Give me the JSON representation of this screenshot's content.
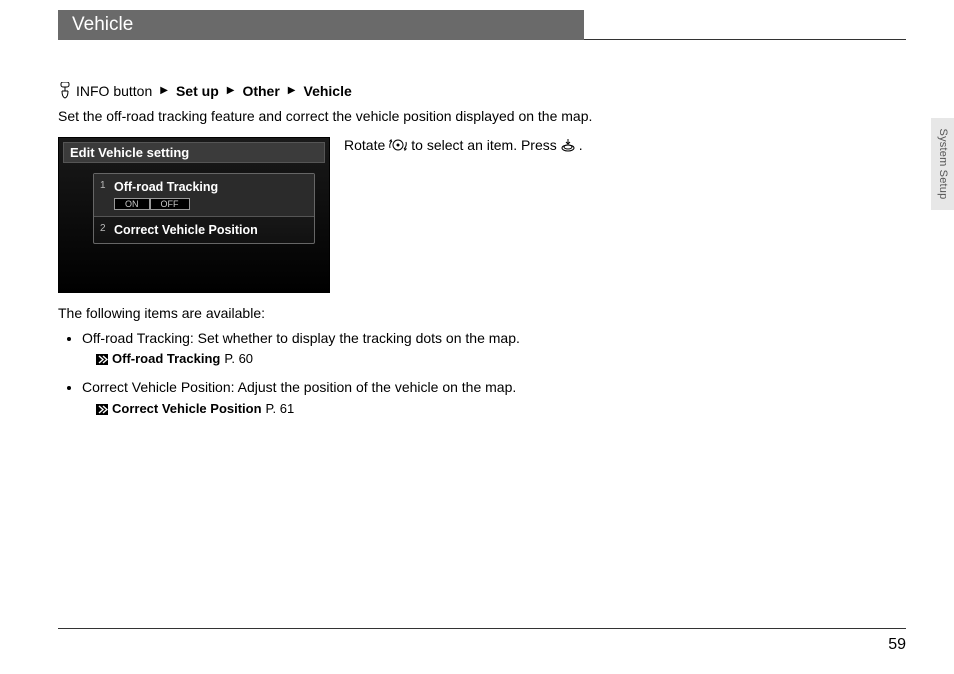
{
  "title": "Vehicle",
  "side_tab": "System Setup",
  "breadcrumb": {
    "info_button": "INFO button",
    "set_up": "Set up",
    "other": "Other",
    "vehicle": "Vehicle"
  },
  "description": "Set the off-road tracking feature and correct the vehicle position displayed on the map.",
  "screenshot": {
    "header": "Edit Vehicle setting",
    "row1_num": "1",
    "row1_label": "Off-road Tracking",
    "on": "ON",
    "off": "OFF",
    "row2_num": "2",
    "row2_label": "Correct Vehicle Position"
  },
  "rotate_line": {
    "a": "Rotate",
    "b": "to select an item. Press",
    "c": "."
  },
  "available_intro": "The following items are available:",
  "item1": {
    "name": "Off-road Tracking",
    "desc": ": Set whether to display the tracking dots on the map.",
    "ref_label": "Off-road Tracking",
    "ref_page": "P. 60"
  },
  "item2": {
    "name": "Correct Vehicle Position",
    "desc": ": Adjust the position of the vehicle on the map.",
    "ref_label": "Correct Vehicle Position",
    "ref_page": "P. 61"
  },
  "page_number": "59"
}
